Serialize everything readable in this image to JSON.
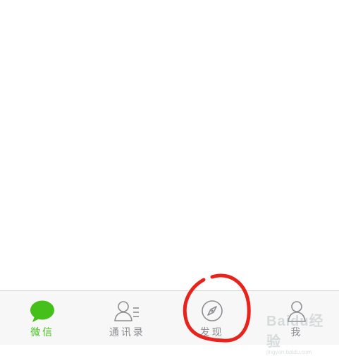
{
  "tabbar": {
    "tabs": [
      {
        "label": "微信",
        "icon": "chat-bubble-icon",
        "active": true
      },
      {
        "label": "通讯录",
        "icon": "contacts-icon",
        "active": false
      },
      {
        "label": "发现",
        "icon": "compass-icon",
        "active": false
      },
      {
        "label": "我",
        "icon": "person-icon",
        "active": false
      }
    ]
  },
  "watermark": {
    "main": "Baidu经验",
    "sub": "jingyan.baidu.com"
  },
  "colors": {
    "active": "#45c01a",
    "inactive": "#8e8e93",
    "tabbar_bg": "#f7f7f7",
    "annotation": "#e8231b"
  }
}
